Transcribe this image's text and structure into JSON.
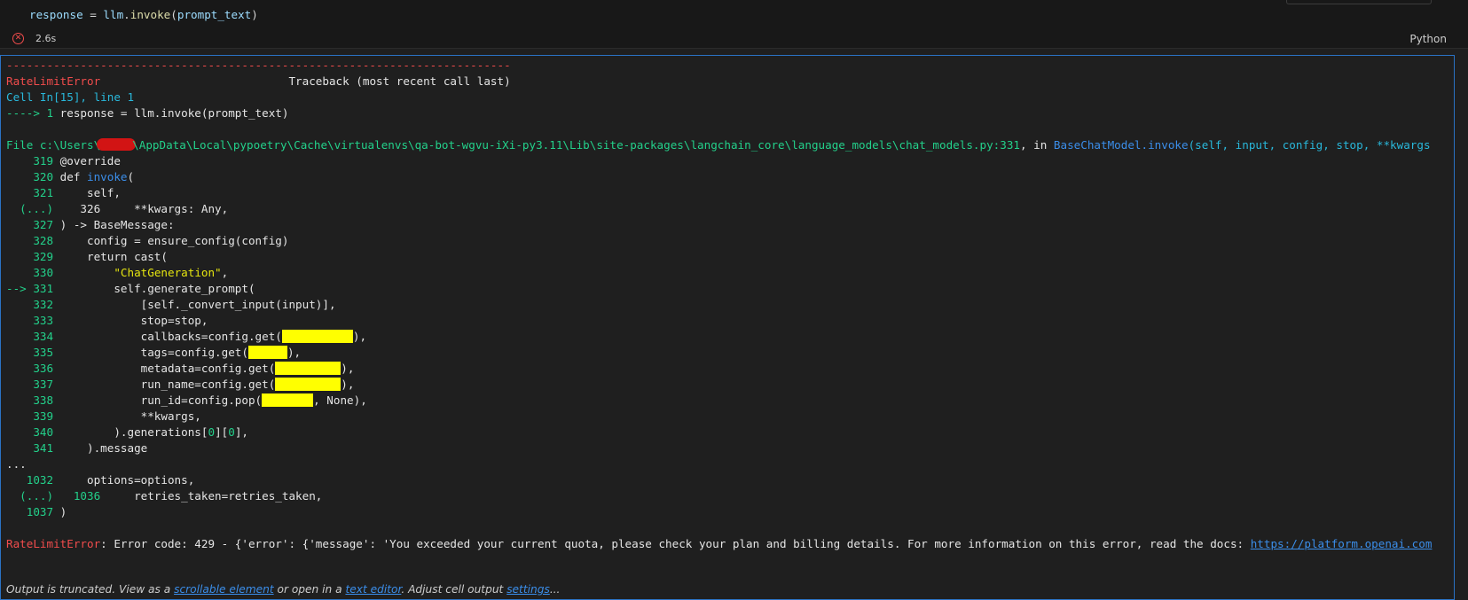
{
  "input_cell": {
    "code": {
      "var": "response",
      "op": " = ",
      "obj": "llm",
      "dot": ".",
      "fn": "invoke",
      "open": "(",
      "arg": "prompt_text",
      "close": ")"
    }
  },
  "status": {
    "icon": "error-circle-icon",
    "exec_time": "2.6s",
    "language": "Python"
  },
  "output": {
    "dashes": "---------------------------------------------------------------------------",
    "error_type": "RateLimitError",
    "traceback_header": "                            Traceback (most recent call last)",
    "cell_ref": "Cell In[15], line 1",
    "arrow_line_prefix": "----> 1",
    "arrow_line_code": " response = llm.invoke(prompt_text)",
    "file_prefix": "File c:\\Users\\",
    "file_path_rest": "\\AppData\\Local\\pypoetry\\Cache\\virtualenvs\\qa-bot-wgvu-iXi-py3.11\\Lib\\site-packages\\langchain_core\\language_models\\chat_models.py:331",
    "file_in": ", in ",
    "file_func": "BaseChatModel.invoke",
    "file_sig": "(self, input, config, stop, **kwargs",
    "code_lines": [
      {
        "no": "    319",
        "code": " @override"
      },
      {
        "no": "    320",
        "code": " def ",
        "fn": "invoke",
        "tail": "("
      },
      {
        "no": "    321",
        "code": "     self,"
      },
      {
        "no": "  (...)",
        "code": "    326     **kwargs: Any,"
      },
      {
        "no": "    327",
        "code": " ) -> BaseMessage:"
      },
      {
        "no": "    328",
        "code": "     config = ensure_config(config)"
      },
      {
        "no": "    329",
        "code": "     return cast("
      },
      {
        "no": "    330",
        "code": "         ",
        "str": "\"ChatGeneration\"",
        "tail": ","
      },
      {
        "no": "--> 331",
        "code": "         self.generate_prompt("
      },
      {
        "no": "    332",
        "code": "             [self._convert_input(input)],"
      },
      {
        "no": "    333",
        "code": "             stop=stop,"
      },
      {
        "no": "    334",
        "code": "             callbacks=config.get(",
        "redact": "w80",
        "tail": "),"
      },
      {
        "no": "    335",
        "code": "             tags=config.get(",
        "redact": "w44",
        "tail": "),"
      },
      {
        "no": "    336",
        "code": "             metadata=config.get(",
        "redact": "w74",
        "tail": "),"
      },
      {
        "no": "    337",
        "code": "             run_name=config.get(",
        "redact": "w74",
        "tail": "),"
      },
      {
        "no": "    338",
        "code": "             run_id=config.pop(",
        "redact": "w58",
        "tail": ", None),"
      },
      {
        "no": "    339",
        "code": "             **kwargs,"
      },
      {
        "no": "    340",
        "code": "         ).generations[",
        "n1": "0",
        "mid": "][",
        "n2": "0",
        "tail": "],"
      },
      {
        "no": "    341",
        "code": "     ).message"
      }
    ],
    "ellipsis": "...",
    "tail_lines": [
      {
        "no": "   1032",
        "code": "     options=options,"
      },
      {
        "no": "  (...)",
        "no2": "   1036",
        "code": "     retries_taken=retries_taken,"
      },
      {
        "no": "   1037",
        "code": " )"
      }
    ],
    "final_error_msg": ": Error code: 429 - {'error': {'message': 'You exceeded your current quota, please check your plan and billing details. For more information on this error, read the docs: ",
    "final_error_link": "https://platform.openai.com",
    "footer": {
      "t1": "Output is truncated. View as a ",
      "l1": "scrollable element",
      "t2": " or open in a ",
      "l2": "text editor",
      "t3": ". Adjust cell output ",
      "l3": "settings",
      "t4": "..."
    }
  }
}
